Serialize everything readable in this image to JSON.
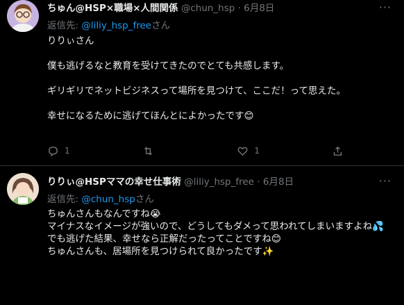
{
  "colors": {
    "background": "#000000",
    "text": "#e7e9ea",
    "muted": "#71767b",
    "link": "#1d9bf0",
    "divider": "#2f3336"
  },
  "tweets": [
    {
      "name": "ちゅん@HSP×職場×人間関係",
      "handle": "@chun_hsp",
      "dot": "·",
      "date": "6月8日",
      "reply_prefix": "返信先: ",
      "reply_mention": "@liliy_hsp_free",
      "reply_suffix": "さん",
      "lines": [
        "りりぃさん",
        "",
        "僕も逃げるなと教育を受けてきたのでとても共感します。",
        "",
        "ギリギリでネットビジネスって場所を見つけて、ここだ！って思えた。",
        "",
        "幸せになるために逃げてほんとによかったです😊"
      ],
      "actions": {
        "reply_count": "1",
        "retweet_count": "",
        "like_count": "1"
      }
    },
    {
      "name": "りりぃ@HSPママの幸せ仕事術",
      "handle": "@liliy_hsp_free",
      "dot": "·",
      "date": "6月8日",
      "reply_prefix": "返信先: ",
      "reply_mention": "@chun_hsp",
      "reply_suffix": "さん",
      "lines": [
        "ちゅんさんもなんですね😭",
        "マイナスなイメージが強いので、どうしてもダメって思われてしまいますよね💦",
        "でも逃げた結果、幸せなら正解だったってことですね😊",
        "ちゅんさんも、居場所を見つけられて良かったです✨"
      ]
    }
  ],
  "icons": [
    "more-icon",
    "reply-icon",
    "retweet-icon",
    "like-icon",
    "share-icon"
  ]
}
